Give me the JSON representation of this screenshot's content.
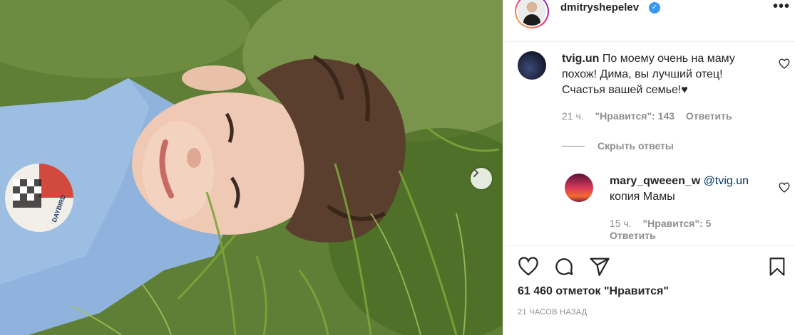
{
  "post": {
    "author": "dmitryshepelev",
    "verified": true,
    "photo": {
      "patch_letters": "DAYBIRD"
    }
  },
  "comments": [
    {
      "username": "tvig.un",
      "text": "По моему очень на маму похож! Дима, вы лучший отец! Счастья вашей семье!♥",
      "time": "21 ч.",
      "likes": "\"Нравится\": 143",
      "reply_label": "Ответить",
      "hide_replies": "Скрыть ответы",
      "replies": [
        {
          "username": "mary_qweeen_w",
          "mention": "@tvig.un",
          "text": "копия Мамы",
          "time": "15 ч.",
          "likes": "\"Нравится\": 5",
          "reply_label": "Ответить"
        }
      ]
    }
  ],
  "footer": {
    "likes_count": "61 460 отметок \"Нравится\"",
    "timestamp": "21 ЧАСОВ НАЗАД"
  },
  "icons": {
    "like": "heart-icon",
    "comment": "comment-icon",
    "share": "share-icon",
    "save": "bookmark-icon",
    "more": "more-icon",
    "next": "chevron-right-icon",
    "verified": "verified-badge-icon"
  },
  "colors": {
    "verified": "#3897f0",
    "secondary_text": "#8e8e8e",
    "mention": "#00376b"
  }
}
